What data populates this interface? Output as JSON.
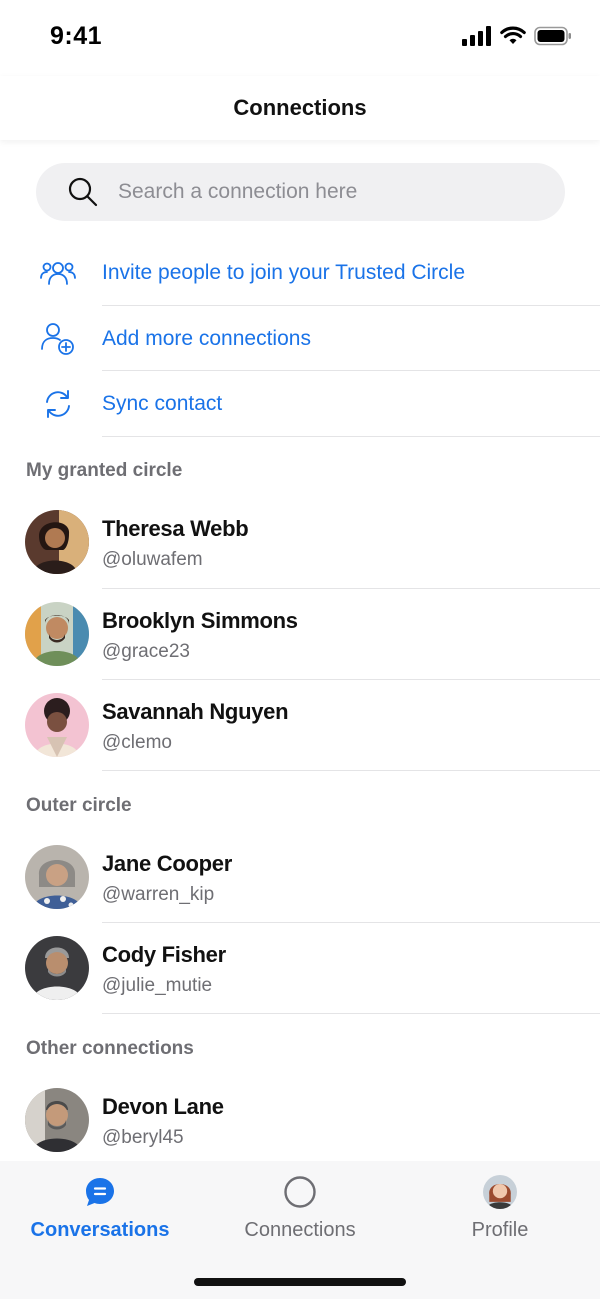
{
  "status_bar": {
    "time": "9:41"
  },
  "header": {
    "title": "Connections"
  },
  "search": {
    "placeholder": "Search a connection here",
    "value": ""
  },
  "actions": [
    {
      "label": "Invite people to join your Trusted Circle",
      "icon": "group-icon"
    },
    {
      "label": "Add more connections",
      "icon": "add-person-icon"
    },
    {
      "label": "Sync contact",
      "icon": "sync-icon"
    }
  ],
  "sections": [
    {
      "title": "My granted circle",
      "contacts": [
        {
          "name": "Theresa Webb",
          "handle": "@oluwafem",
          "avatar_color": "#5a3a2e"
        },
        {
          "name": "Brooklyn Simmons",
          "handle": "@grace23",
          "avatar_color": "#7a9a8a"
        },
        {
          "name": "Savannah Nguyen",
          "handle": "@clemo",
          "avatar_color": "#f2b6c8"
        }
      ]
    },
    {
      "title": "Outer circle",
      "contacts": [
        {
          "name": "Jane Cooper",
          "handle": "@warren_kip",
          "avatar_color": "#8a8f96"
        },
        {
          "name": "Cody Fisher",
          "handle": "@julie_mutie",
          "avatar_color": "#3e3e42"
        }
      ]
    },
    {
      "title": "Other connections",
      "contacts": [
        {
          "name": "Devon Lane",
          "handle": "@beryl45",
          "avatar_color": "#6b6b6b"
        }
      ]
    }
  ],
  "tabbar": {
    "tabs": [
      {
        "label": "Conversations",
        "icon": "chat-bubble-icon",
        "active": true
      },
      {
        "label": "Connections",
        "icon": "circle-icon",
        "active": false
      },
      {
        "label": "Profile",
        "icon": "profile-avatar",
        "active": false
      }
    ]
  },
  "colors": {
    "accent": "#1a73e8",
    "text_secondary": "#6e6e73",
    "search_bg": "#f0f0f2"
  }
}
